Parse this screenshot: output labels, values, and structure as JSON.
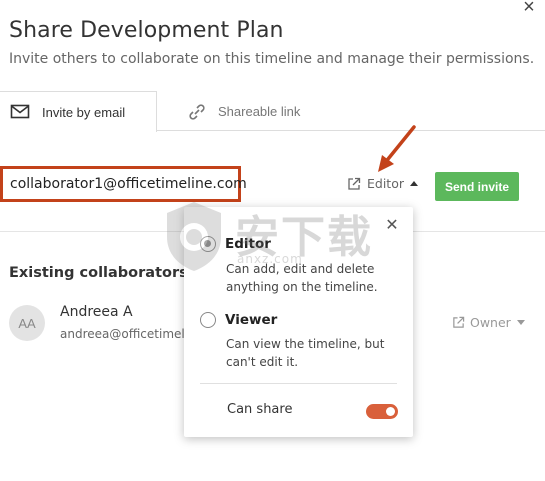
{
  "dialog": {
    "title": "Share Development Plan",
    "subtitle": "Invite others to collaborate on this timeline and manage their permissions."
  },
  "tabs": [
    {
      "label": "Invite by email",
      "icon": "envelope-icon",
      "active": true
    },
    {
      "label": "Shareable link",
      "icon": "link-icon",
      "active": false
    }
  ],
  "invite": {
    "email_value": "collaborator1@officetimeline.com",
    "role_label": "Editor",
    "send_label": "Send invite"
  },
  "collaborators": {
    "heading": "Existing collaborators (1)",
    "items": [
      {
        "initials": "AA",
        "name": "Andreea A",
        "email": "andreea@officetimeline.com",
        "role": "Owner"
      }
    ]
  },
  "role_popup": {
    "options": [
      {
        "title": "Editor",
        "description": "Can add, edit and delete anything on the timeline.",
        "selected": true
      },
      {
        "title": "Viewer",
        "description": "Can view the timeline, but can't edit it.",
        "selected": false
      }
    ],
    "can_share_label": "Can share",
    "can_share_enabled": true
  },
  "watermark": {
    "text": "安下载",
    "sub": "anxz.com"
  },
  "colors": {
    "accent_green": "#5cb85c",
    "highlight_red": "#c3421a",
    "toggle_orange": "#d9603b"
  }
}
